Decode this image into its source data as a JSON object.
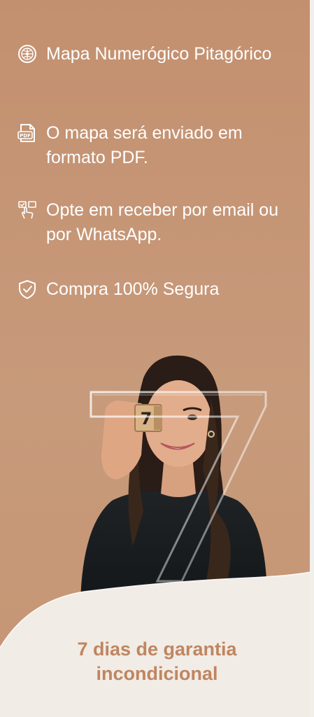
{
  "features": [
    {
      "icon": "globe-seal-icon",
      "text": "Mapa Numerógico Pitagórico"
    },
    {
      "icon": "pdf-file-icon",
      "text": "O mapa será enviado em formato PDF."
    },
    {
      "icon": "touch-select-icon",
      "text": "Opte em receber por email ou por WhatsApp."
    },
    {
      "icon": "shield-check-icon",
      "text": "Compra 100% Segura"
    }
  ],
  "photo": {
    "cube_number": "7",
    "big_number": "7"
  },
  "guarantee": {
    "line1": "7 dias de garantia",
    "line2": "incondicional"
  },
  "colors": {
    "background": "#c49473",
    "text_light": "#ffffff",
    "accent": "#c08560",
    "wave": "#f1ece6"
  }
}
